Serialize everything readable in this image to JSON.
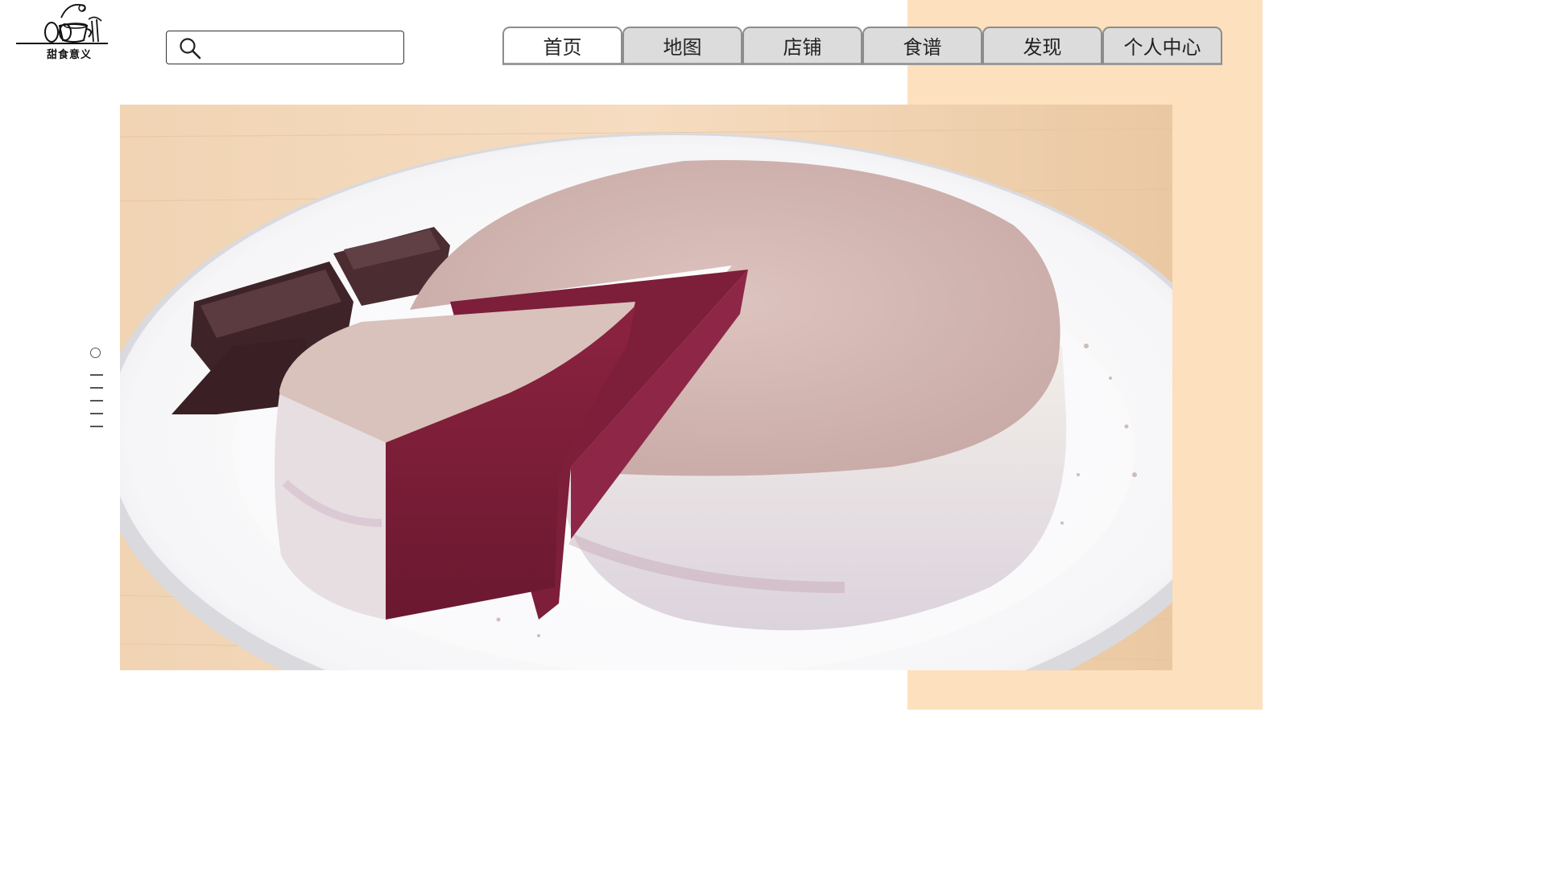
{
  "brand": {
    "logo_text": "甜食意义",
    "logo_icon": "cup-spoon-logo-icon",
    "panel_color": "#fde0bd"
  },
  "search": {
    "icon": "search-icon",
    "placeholder": "",
    "value": ""
  },
  "nav": {
    "tabs": [
      {
        "label": "首页",
        "active": true
      },
      {
        "label": "地图",
        "active": false
      },
      {
        "label": "店铺",
        "active": false
      },
      {
        "label": "食谱",
        "active": false
      },
      {
        "label": "发现",
        "active": false
      },
      {
        "label": "个人中心",
        "active": false
      }
    ]
  },
  "hero": {
    "image_subject": "red velvet cake with powdered cocoa topping and chocolate pieces on white plate"
  },
  "pager": {
    "count": 6,
    "current": 1
  }
}
